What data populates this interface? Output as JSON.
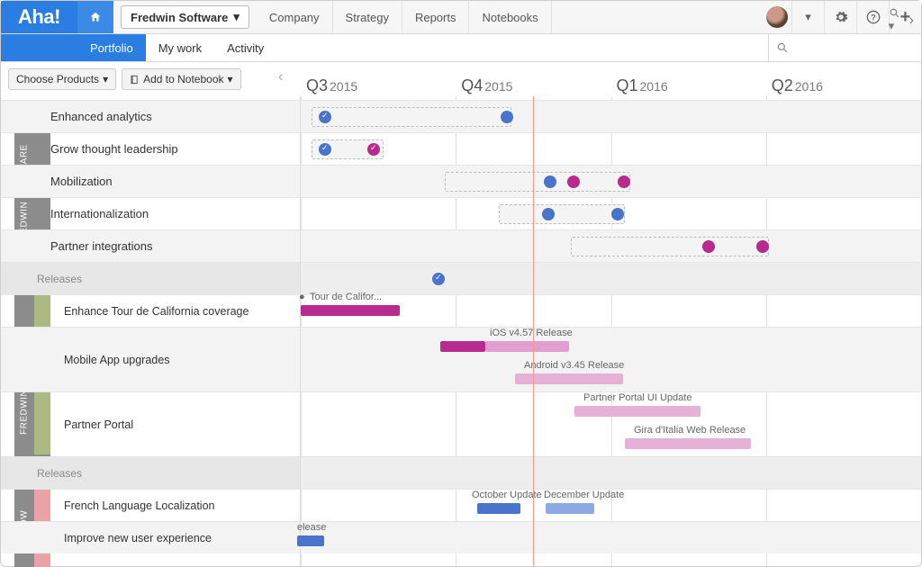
{
  "logo": "Aha!",
  "workspace": "Fredwin Software",
  "topnav": [
    "Company",
    "Strategy",
    "Reports",
    "Notebooks"
  ],
  "secondary": {
    "active": "Portfolio",
    "items": [
      "Portfolio",
      "My work",
      "Activity"
    ]
  },
  "toolbar": {
    "choose": "Choose Products",
    "notebook": "Add to Notebook"
  },
  "quarters": [
    {
      "q": "Q3",
      "y": "2015"
    },
    {
      "q": "Q4",
      "y": "2015"
    },
    {
      "q": "Q1",
      "y": "2016"
    },
    {
      "q": "Q2",
      "y": "2016"
    }
  ],
  "groups": {
    "g1": "FREDWIN SOFTWARE",
    "g2": "FREDWIN CYCLING",
    "g3": "FREDW"
  },
  "rows": {
    "r1": "Enhanced analytics",
    "r2": "Grow thought leadership",
    "r3": "Mobilization",
    "r4": "Internationalization",
    "r5": "Partner integrations",
    "r6": "Releases",
    "r7": "Enhance Tour de California coverage",
    "r8": "Mobile App upgrades",
    "r9": "Partner Portal",
    "r10": "Releases",
    "r11": "French Language Localization",
    "r12": "Improve new user experience"
  },
  "labels": {
    "tour": "Tour de Califor...",
    "ios": "iOS v4.57 Release",
    "android": "Android v3.45 Release",
    "portalui": "Partner Portal UI Update",
    "gira": "Gira d'Italia Web Release",
    "oct": "October Update",
    "dec": "December Update",
    "rel": "elease"
  }
}
